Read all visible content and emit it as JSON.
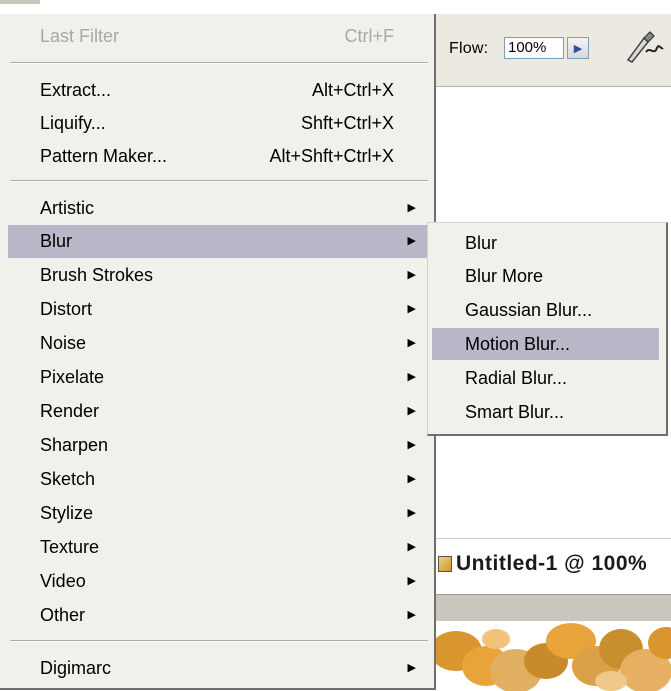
{
  "options_bar": {
    "flow_label": "Flow:",
    "flow_value": "100%"
  },
  "document": {
    "title": "Untitled-1 @ 100%"
  },
  "filter_menu": {
    "last_filter": {
      "label": "Last Filter",
      "shortcut": "Ctrl+F",
      "enabled": false
    },
    "top_items": [
      {
        "label": "Extract...",
        "shortcut": "Alt+Ctrl+X"
      },
      {
        "label": "Liquify...",
        "shortcut": "Shft+Ctrl+X"
      },
      {
        "label": "Pattern Maker...",
        "shortcut": "Alt+Shft+Ctrl+X"
      }
    ],
    "submenus": [
      {
        "label": "Artistic"
      },
      {
        "label": "Blur",
        "highlighted": true
      },
      {
        "label": "Brush Strokes"
      },
      {
        "label": "Distort"
      },
      {
        "label": "Noise"
      },
      {
        "label": "Pixelate"
      },
      {
        "label": "Render"
      },
      {
        "label": "Sharpen"
      },
      {
        "label": "Sketch"
      },
      {
        "label": "Stylize"
      },
      {
        "label": "Texture"
      },
      {
        "label": "Video"
      },
      {
        "label": "Other"
      }
    ],
    "bottom_items": [
      {
        "label": "Digimarc"
      }
    ]
  },
  "blur_submenu": {
    "items": [
      {
        "label": "Blur"
      },
      {
        "label": "Blur More"
      },
      {
        "label": "Gaussian Blur..."
      },
      {
        "label": "Motion Blur...",
        "highlighted": true
      },
      {
        "label": "Radial Blur..."
      },
      {
        "label": "Smart Blur..."
      }
    ]
  },
  "colors": {
    "menu_bg": "#f1f0ea",
    "highlight": "#b9b8c9",
    "disabled_text": "#a9a9a3",
    "canvas_paint": "#e8a43a"
  },
  "icons": {
    "submenu_arrow": "triangle-right-icon",
    "airbrush": "airbrush-icon",
    "flow_arrow": "flyout-arrow-icon",
    "document": "document-icon"
  }
}
